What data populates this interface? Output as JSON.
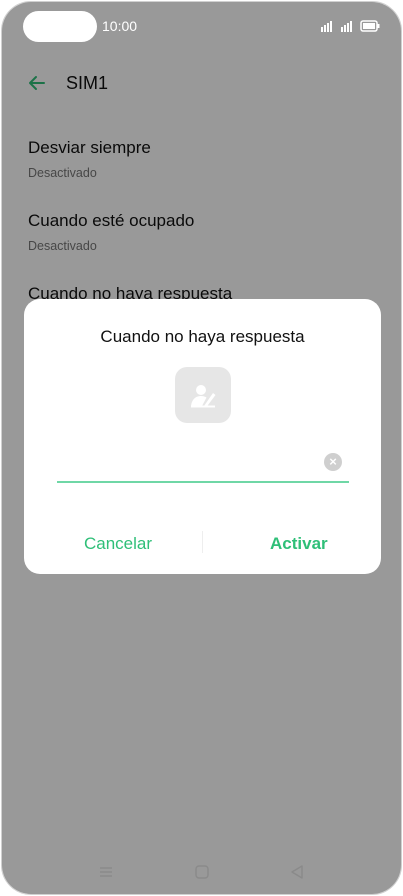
{
  "status_bar": {
    "time": "10:00"
  },
  "app_bar": {
    "title": "SIM1"
  },
  "settings": {
    "items": [
      {
        "title": "Desviar siempre",
        "subtitle": "Desactivado"
      },
      {
        "title": "Cuando esté ocupado",
        "subtitle": "Desactivado"
      },
      {
        "title": "Cuando no haya respuesta"
      }
    ]
  },
  "dialog": {
    "title": "Cuando no haya respuesta",
    "input_value": "",
    "cancel_label": "Cancelar",
    "confirm_label": "Activar"
  },
  "colors": {
    "accent": "#2fbf78",
    "input_line": "#6fd7a6",
    "scrim": "rgba(0,0,0,0.40)"
  },
  "icons": {
    "back": "arrow-left-icon",
    "contact": "contact-picker-icon",
    "clear": "clear-input-icon",
    "nav_menu": "menu-icon",
    "nav_home": "home-icon",
    "nav_back": "back-triangle-icon"
  }
}
